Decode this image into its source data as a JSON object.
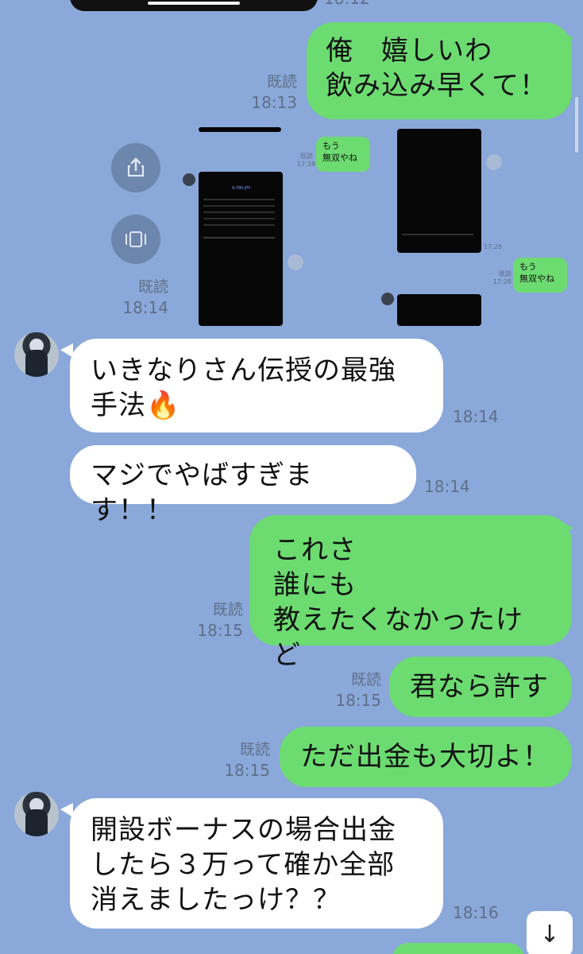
{
  "messages": [
    {
      "type": "outgoing",
      "text": "俺　嬉しいわ\n飲み込み早くて！",
      "read": "既読",
      "time": "18:13"
    },
    {
      "type": "image-group",
      "read": "既読",
      "time": "18:14",
      "thumb_left": {
        "read": "既読",
        "time": "17:28",
        "bubble": "もう\n無双やね"
      },
      "thumb_right": {
        "read": "既読",
        "time": "17:28",
        "bubble": "もう\n無双やね"
      },
      "phone_label": "4,780 JPY"
    },
    {
      "type": "incoming",
      "text": "いきなりさん伝授の最強手法🔥",
      "time": "18:14"
    },
    {
      "type": "incoming",
      "text": "マジでやばすぎます！！",
      "time": "18:14"
    },
    {
      "type": "outgoing",
      "text": "これさ\n誰にも\n教えたくなかったけど",
      "read": "既読",
      "time": "18:15"
    },
    {
      "type": "outgoing",
      "text": "君なら許す",
      "read": "既読",
      "time": "18:15"
    },
    {
      "type": "outgoing",
      "text": "ただ出金も大切よ！",
      "read": "既読",
      "time": "18:15"
    },
    {
      "type": "incoming",
      "text": "開設ボーナスの場合出金したら３万って確か全部消えましたっけ？？",
      "time": "18:16"
    }
  ],
  "icons": {
    "share": "share-icon",
    "gallery": "gallery-icon",
    "scroll_down": "arrow-down-icon"
  },
  "colors": {
    "background": "#8aa8d9",
    "outgoing_bubble": "#6cdb70",
    "incoming_bubble": "#ffffff",
    "meta_text": "#5f6f86"
  }
}
